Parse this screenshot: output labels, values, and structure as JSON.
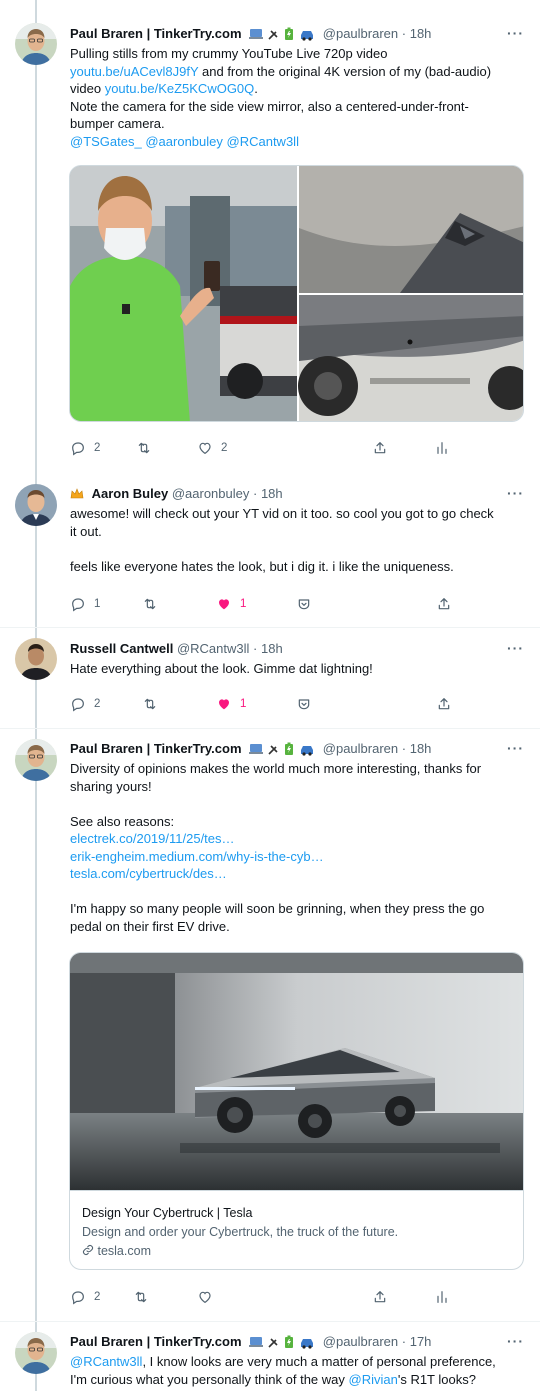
{
  "colors": {
    "link": "#1d9bf0",
    "text": "#0f1419",
    "muted": "#536471",
    "like": "#f91880",
    "thread_line": "#cfd9de"
  },
  "tweets": [
    {
      "name": "Paul Braren | TinkerTry.com",
      "badges": [
        "laptop-emoji",
        "plug-emoji",
        "battery-emoji",
        "car-emoji"
      ],
      "handle": "@paulbraren",
      "sep": "·",
      "time": "18h",
      "more": "···",
      "lines": {
        "l1": "Pulling stills from my crummy YouTube Live 720p video",
        "l2_link": "youtu.be/uACevl8J9fY",
        "l2_text": " and from the original 4K version of my (bad-audio)",
        "l3_text": "video ",
        "l3_link": "youtu.be/KeZ5KCwOG0Q",
        "l3_end": ".",
        "l4": "Note the camera for the side view mirror, also a centered-under-front-",
        "l5": "bumper camera.",
        "l6_m1": "@TSGates_",
        "l6_m2": "@aaronbuley",
        "l6_m3": "@RCantw3ll"
      },
      "actions": {
        "reply": "2",
        "retweet": "",
        "like": "2"
      }
    },
    {
      "name": "Aaron Buley",
      "handle": "@aaronbuley",
      "sep": "·",
      "time": "18h",
      "more": "···",
      "lines": {
        "l1": "awesome!  will check out your YT vid on it too.  so cool you got to go check",
        "l2": "it out.",
        "l3": "",
        "l4": "feels like everyone hates the look, but i dig it.  i like the uniqueness."
      },
      "actions": {
        "reply": "1",
        "retweet": "",
        "like": "1"
      }
    },
    {
      "name": "Russell Cantwell",
      "handle": "@RCantw3ll",
      "sep": "·",
      "time": "18h",
      "more": "···",
      "lines": {
        "l1": "Hate everything about the look. Gimme dat lightning!"
      },
      "actions": {
        "reply": "2",
        "retweet": "",
        "like": "1"
      }
    },
    {
      "name": "Paul Braren | TinkerTry.com",
      "badges": [
        "laptop-emoji",
        "plug-emoji",
        "battery-emoji",
        "car-emoji"
      ],
      "handle": "@paulbraren",
      "sep": "·",
      "time": "18h",
      "more": "···",
      "lines": {
        "l1": "Diversity of opinions makes the world much more interesting, thanks for",
        "l2": "sharing yours!",
        "l3": "",
        "l4": "See also reasons:",
        "l5_link": "electrek.co/2019/11/25/tes…",
        "l6_link": "erik-engheim.medium.com/why-is-the-cyb…",
        "l7_link": "tesla.com/cybertruck/des…",
        "l8": "",
        "l9": "I'm happy so many people will soon be grinning, when they press the go",
        "l10": "pedal on their first EV drive."
      },
      "card": {
        "title": "Design Your Cybertruck | Tesla",
        "description": "Design and order your Cybertruck, the truck of the future.",
        "domain": "tesla.com"
      },
      "actions": {
        "reply": "2",
        "retweet": "",
        "like": ""
      }
    },
    {
      "name": "Paul Braren | TinkerTry.com",
      "badges": [
        "laptop-emoji",
        "plug-emoji",
        "battery-emoji",
        "car-emoji"
      ],
      "handle": "@paulbraren",
      "sep": "·",
      "time": "17h",
      "more": "···",
      "lines": {
        "l1_m": "@RCantw3ll",
        "l1_text": ", I know looks are very much a matter of personal preference,",
        "l2_text": "I'm curious what you personally think of the way ",
        "l2_m": "@Rivian",
        "l2_end": "'s R1T looks?"
      }
    }
  ]
}
